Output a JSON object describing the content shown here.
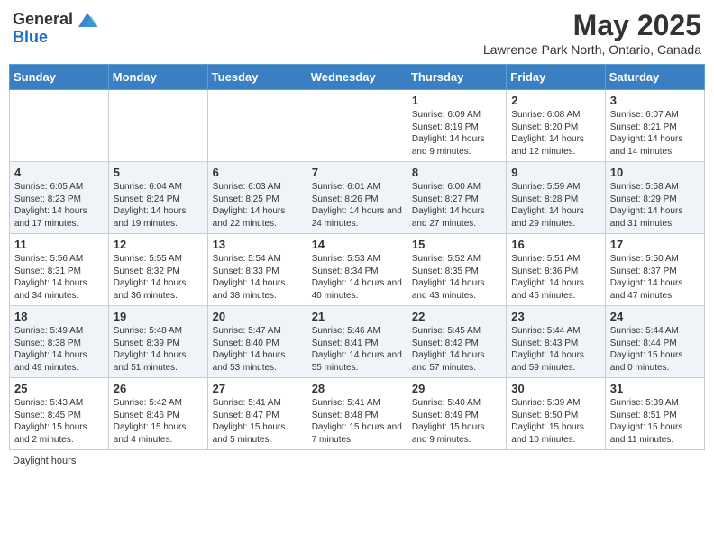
{
  "header": {
    "logo_general": "General",
    "logo_blue": "Blue",
    "month_title": "May 2025",
    "location": "Lawrence Park North, Ontario, Canada"
  },
  "calendar": {
    "days": [
      "Sunday",
      "Monday",
      "Tuesday",
      "Wednesday",
      "Thursday",
      "Friday",
      "Saturday"
    ],
    "weeks": [
      [
        {
          "day": "",
          "content": ""
        },
        {
          "day": "",
          "content": ""
        },
        {
          "day": "",
          "content": ""
        },
        {
          "day": "",
          "content": ""
        },
        {
          "day": "1",
          "content": "Sunrise: 6:09 AM\nSunset: 8:19 PM\nDaylight: 14 hours\nand 9 minutes."
        },
        {
          "day": "2",
          "content": "Sunrise: 6:08 AM\nSunset: 8:20 PM\nDaylight: 14 hours\nand 12 minutes."
        },
        {
          "day": "3",
          "content": "Sunrise: 6:07 AM\nSunset: 8:21 PM\nDaylight: 14 hours\nand 14 minutes."
        }
      ],
      [
        {
          "day": "4",
          "content": "Sunrise: 6:05 AM\nSunset: 8:23 PM\nDaylight: 14 hours\nand 17 minutes."
        },
        {
          "day": "5",
          "content": "Sunrise: 6:04 AM\nSunset: 8:24 PM\nDaylight: 14 hours\nand 19 minutes."
        },
        {
          "day": "6",
          "content": "Sunrise: 6:03 AM\nSunset: 8:25 PM\nDaylight: 14 hours\nand 22 minutes."
        },
        {
          "day": "7",
          "content": "Sunrise: 6:01 AM\nSunset: 8:26 PM\nDaylight: 14 hours\nand 24 minutes."
        },
        {
          "day": "8",
          "content": "Sunrise: 6:00 AM\nSunset: 8:27 PM\nDaylight: 14 hours\nand 27 minutes."
        },
        {
          "day": "9",
          "content": "Sunrise: 5:59 AM\nSunset: 8:28 PM\nDaylight: 14 hours\nand 29 minutes."
        },
        {
          "day": "10",
          "content": "Sunrise: 5:58 AM\nSunset: 8:29 PM\nDaylight: 14 hours\nand 31 minutes."
        }
      ],
      [
        {
          "day": "11",
          "content": "Sunrise: 5:56 AM\nSunset: 8:31 PM\nDaylight: 14 hours\nand 34 minutes."
        },
        {
          "day": "12",
          "content": "Sunrise: 5:55 AM\nSunset: 8:32 PM\nDaylight: 14 hours\nand 36 minutes."
        },
        {
          "day": "13",
          "content": "Sunrise: 5:54 AM\nSunset: 8:33 PM\nDaylight: 14 hours\nand 38 minutes."
        },
        {
          "day": "14",
          "content": "Sunrise: 5:53 AM\nSunset: 8:34 PM\nDaylight: 14 hours\nand 40 minutes."
        },
        {
          "day": "15",
          "content": "Sunrise: 5:52 AM\nSunset: 8:35 PM\nDaylight: 14 hours\nand 43 minutes."
        },
        {
          "day": "16",
          "content": "Sunrise: 5:51 AM\nSunset: 8:36 PM\nDaylight: 14 hours\nand 45 minutes."
        },
        {
          "day": "17",
          "content": "Sunrise: 5:50 AM\nSunset: 8:37 PM\nDaylight: 14 hours\nand 47 minutes."
        }
      ],
      [
        {
          "day": "18",
          "content": "Sunrise: 5:49 AM\nSunset: 8:38 PM\nDaylight: 14 hours\nand 49 minutes."
        },
        {
          "day": "19",
          "content": "Sunrise: 5:48 AM\nSunset: 8:39 PM\nDaylight: 14 hours\nand 51 minutes."
        },
        {
          "day": "20",
          "content": "Sunrise: 5:47 AM\nSunset: 8:40 PM\nDaylight: 14 hours\nand 53 minutes."
        },
        {
          "day": "21",
          "content": "Sunrise: 5:46 AM\nSunset: 8:41 PM\nDaylight: 14 hours\nand 55 minutes."
        },
        {
          "day": "22",
          "content": "Sunrise: 5:45 AM\nSunset: 8:42 PM\nDaylight: 14 hours\nand 57 minutes."
        },
        {
          "day": "23",
          "content": "Sunrise: 5:44 AM\nSunset: 8:43 PM\nDaylight: 14 hours\nand 59 minutes."
        },
        {
          "day": "24",
          "content": "Sunrise: 5:44 AM\nSunset: 8:44 PM\nDaylight: 15 hours\nand 0 minutes."
        }
      ],
      [
        {
          "day": "25",
          "content": "Sunrise: 5:43 AM\nSunset: 8:45 PM\nDaylight: 15 hours\nand 2 minutes."
        },
        {
          "day": "26",
          "content": "Sunrise: 5:42 AM\nSunset: 8:46 PM\nDaylight: 15 hours\nand 4 minutes."
        },
        {
          "day": "27",
          "content": "Sunrise: 5:41 AM\nSunset: 8:47 PM\nDaylight: 15 hours\nand 5 minutes."
        },
        {
          "day": "28",
          "content": "Sunrise: 5:41 AM\nSunset: 8:48 PM\nDaylight: 15 hours\nand 7 minutes."
        },
        {
          "day": "29",
          "content": "Sunrise: 5:40 AM\nSunset: 8:49 PM\nDaylight: 15 hours\nand 9 minutes."
        },
        {
          "day": "30",
          "content": "Sunrise: 5:39 AM\nSunset: 8:50 PM\nDaylight: 15 hours\nand 10 minutes."
        },
        {
          "day": "31",
          "content": "Sunrise: 5:39 AM\nSunset: 8:51 PM\nDaylight: 15 hours\nand 11 minutes."
        }
      ]
    ]
  },
  "footer": {
    "daylight_label": "Daylight hours"
  }
}
